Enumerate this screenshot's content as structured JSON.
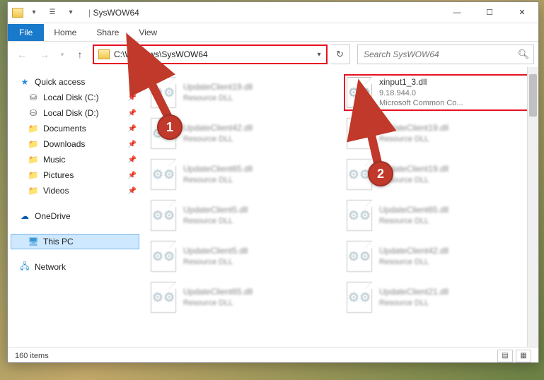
{
  "window": {
    "title": "SysWOW64"
  },
  "ribbon": {
    "file": "File",
    "home": "Home",
    "share": "Share",
    "view": "View"
  },
  "nav": {
    "address": "C:\\Windows\\SysWOW64",
    "search_placeholder": "Search SysWOW64"
  },
  "sidebar": {
    "quick_access": "Quick access",
    "items": [
      {
        "label": "Local Disk (C:)",
        "icon": "disk",
        "pinned": true
      },
      {
        "label": "Local Disk (D:)",
        "icon": "disk",
        "pinned": true
      },
      {
        "label": "Documents",
        "icon": "folder",
        "pinned": true
      },
      {
        "label": "Downloads",
        "icon": "folder",
        "pinned": true
      },
      {
        "label": "Music",
        "icon": "folder",
        "pinned": true
      },
      {
        "label": "Pictures",
        "icon": "folder",
        "pinned": true
      },
      {
        "label": "Videos",
        "icon": "folder",
        "pinned": true
      }
    ],
    "onedrive": "OneDrive",
    "thispc": "This PC",
    "network": "Network"
  },
  "files": {
    "highlighted": {
      "name": "xinput1_3.dll",
      "version": "9.18.944.0",
      "desc": "Microsoft Common Co..."
    },
    "others": [
      {
        "name": "UpdateClient19.dll",
        "sub": "Resource DLL"
      },
      {
        "name": "UpdateClient42.dll",
        "sub": "Resource DLL"
      },
      {
        "name": "UpdateClient19.dll",
        "sub": "Resource DLL"
      },
      {
        "name": "UpdateClient65.dll",
        "sub": "Resource DLL"
      },
      {
        "name": "UpdateClient19.dll",
        "sub": "Resource DLL"
      },
      {
        "name": "UpdateClient5.dll",
        "sub": "Resource DLL"
      },
      {
        "name": "UpdateClient65.dll",
        "sub": "Resource DLL"
      },
      {
        "name": "UpdateClient5.dll",
        "sub": "Resource DLL"
      },
      {
        "name": "UpdateClient42.dll",
        "sub": "Resource DLL"
      },
      {
        "name": "UpdateClient65.dll",
        "sub": "Resource DLL"
      },
      {
        "name": "UpdateClient21.dll",
        "sub": "Resource DLL"
      }
    ]
  },
  "status": {
    "count": "160 items"
  },
  "callouts": {
    "one": "1",
    "two": "2"
  }
}
